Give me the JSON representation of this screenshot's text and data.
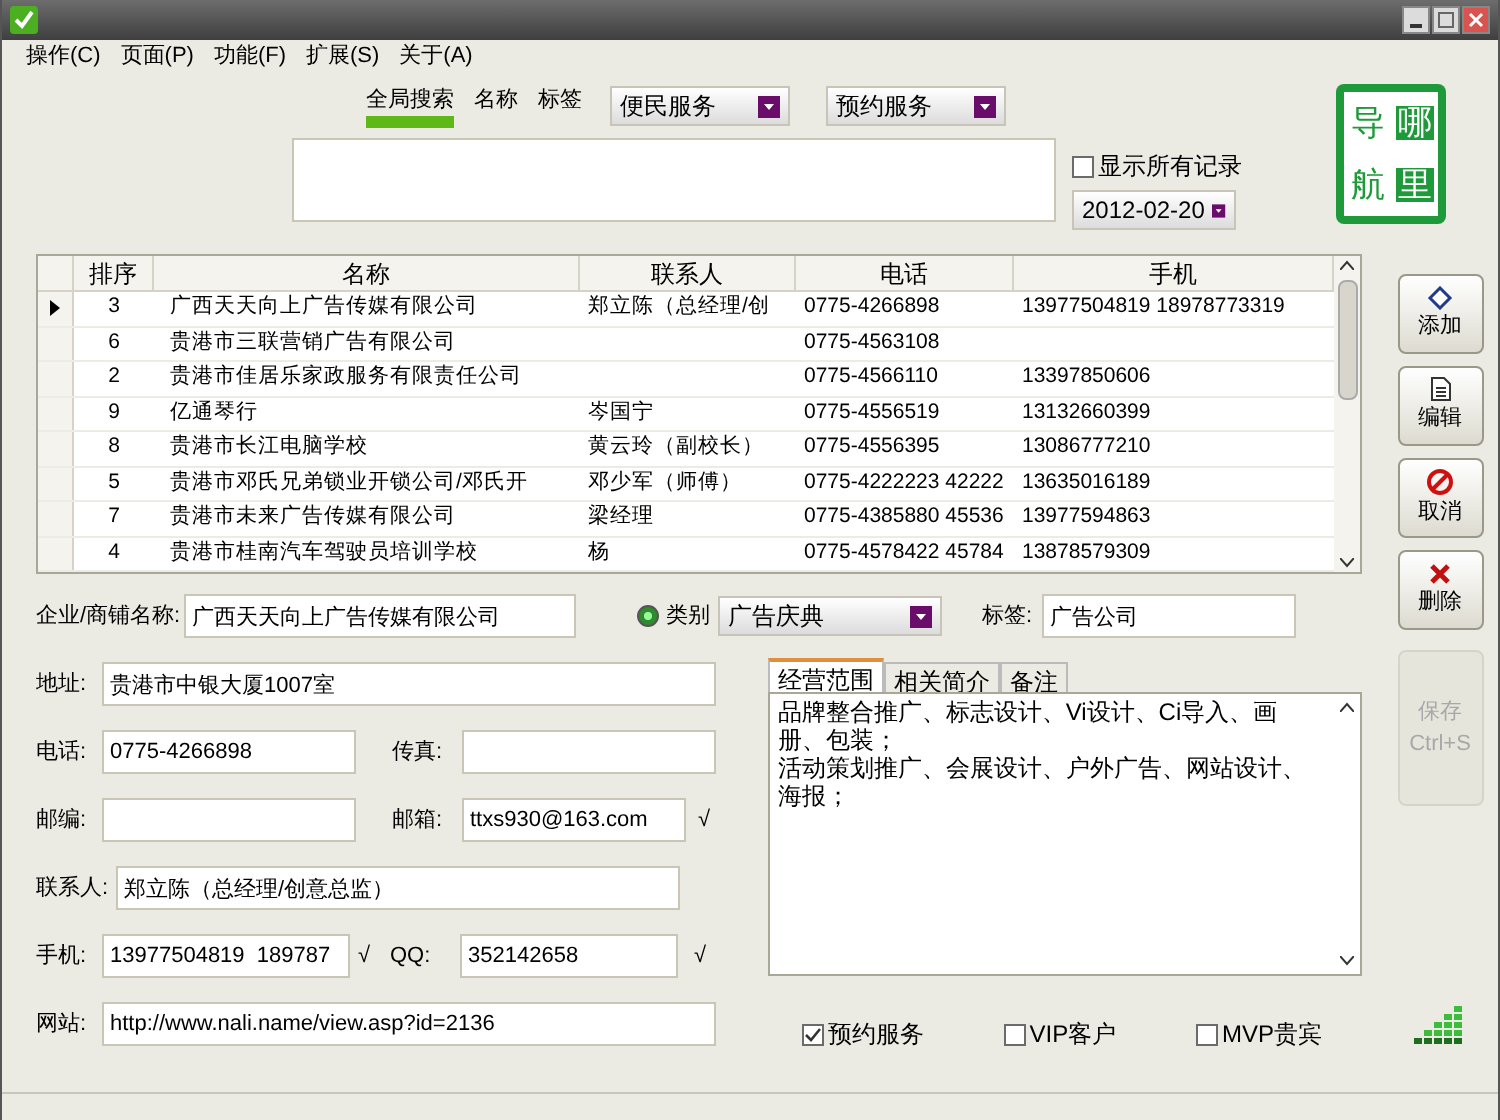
{
  "menu": [
    "操作(C)",
    "页面(P)",
    "功能(F)",
    "扩展(S)",
    "关于(A)"
  ],
  "search": {
    "tabs": [
      {
        "label": "全局搜索",
        "selected": true
      },
      {
        "label": "名称",
        "selected": false
      },
      {
        "label": "标签",
        "selected": false
      }
    ],
    "selects": [
      "便民服务",
      "预约服务"
    ],
    "show_all": {
      "label": "显示所有记录",
      "checked": false
    },
    "date": "2012-02-20"
  },
  "logo": [
    "导",
    "航",
    "哪",
    "里"
  ],
  "table": {
    "columns": [
      "排序",
      "名称",
      "联系人",
      "电话",
      "手机"
    ],
    "rows": [
      {
        "selected": true,
        "cells": [
          "3",
          "广西天天向上广告传媒有限公司",
          "郑立陈（总经理/创",
          "0775-4266898",
          "13977504819  18978773319"
        ]
      },
      {
        "selected": false,
        "cells": [
          "6",
          "贵港市三联营销广告有限公司",
          "",
          "0775-4563108",
          ""
        ]
      },
      {
        "selected": false,
        "cells": [
          "2",
          "贵港市佳居乐家政服务有限责任公司",
          "",
          "0775-4566110",
          "13397850606"
        ]
      },
      {
        "selected": false,
        "cells": [
          "9",
          "亿通琴行",
          "岑国宁",
          "0775-4556519",
          "13132660399"
        ]
      },
      {
        "selected": false,
        "cells": [
          "8",
          "贵港市长江电脑学校",
          "黄云玲（副校长）",
          "0775-4556395",
          "13086777210"
        ]
      },
      {
        "selected": false,
        "cells": [
          "5",
          "贵港市邓氏兄弟锁业开锁公司/邓氏开",
          "邓少军（师傅）",
          "0775-4222223  42222",
          "13635016189"
        ]
      },
      {
        "selected": false,
        "cells": [
          "7",
          "贵港市未来广告传媒有限公司",
          "梁经理",
          "0775-4385880  45536",
          "13977594863"
        ]
      },
      {
        "selected": false,
        "cells": [
          "4",
          "贵港市桂南汽车驾驶员培训学校",
          "杨",
          "0775-4578422  45784",
          "13878579309"
        ]
      }
    ]
  },
  "buttons": [
    {
      "kind": "add",
      "label": "添加",
      "disabled": false
    },
    {
      "kind": "edit",
      "label": "编辑",
      "disabled": false
    },
    {
      "kind": "cancel",
      "label": "取消",
      "disabled": false
    },
    {
      "kind": "delete",
      "label": "删除",
      "disabled": false
    },
    {
      "kind": "save",
      "label": "保存",
      "shortcut": "Ctrl+S",
      "disabled": true
    }
  ],
  "form": {
    "name": {
      "label": "企业/商铺名称:",
      "value": "广西天天向上广告传媒有限公司"
    },
    "category": {
      "label": "类别",
      "value": "广告庆典"
    },
    "tag": {
      "label": "标签:",
      "value": "广告公司"
    },
    "address": {
      "label": "地址:",
      "value": "贵港市中银大厦1007室"
    },
    "phone": {
      "label": "电话:",
      "value": "0775-4266898"
    },
    "fax": {
      "label": "传真:"
    },
    "zip": {
      "label": "邮编:"
    },
    "email": {
      "label": "邮箱:",
      "value": "ttxs930@163.com",
      "mark": "√"
    },
    "contact": {
      "label": "联系人:",
      "value": "郑立陈（总经理/创意总监）"
    },
    "mobile": {
      "label": "手机:",
      "value": "13977504819  189787",
      "mark": "√"
    },
    "qq": {
      "label": "QQ:",
      "value": "352142658",
      "mark": "√"
    },
    "website": {
      "label": "网站:",
      "value": "http://www.nali.name/view.asp?id=2136"
    }
  },
  "detail_tabs": [
    {
      "label": "经营范围",
      "selected": true
    },
    {
      "label": "相关简介",
      "selected": false
    },
    {
      "label": "备注",
      "selected": false
    }
  ],
  "detail_text": [
    "品牌整合推广、标志设计、Vi设计、Ci导入、画册、包装；",
    "活动策划推广、会展设计、户外广告、网站设计、海报；"
  ],
  "options": [
    {
      "label": "预约服务",
      "checked": true
    },
    {
      "label": "VIP客户",
      "checked": false
    },
    {
      "label": "MVP贵宾",
      "checked": false
    }
  ]
}
